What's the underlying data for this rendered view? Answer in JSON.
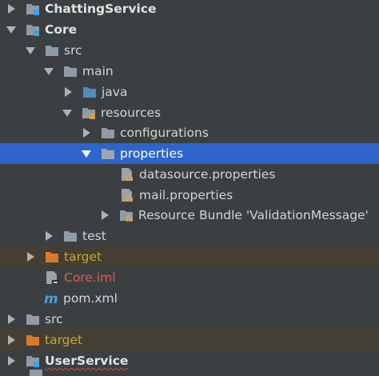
{
  "tree": {
    "items": [
      {
        "label": "ChattingService"
      },
      {
        "label": "Core"
      },
      {
        "label": "src"
      },
      {
        "label": "main"
      },
      {
        "label": "java"
      },
      {
        "label": "resources"
      },
      {
        "label": "configurations"
      },
      {
        "label": "properties"
      },
      {
        "label": "datasource.properties"
      },
      {
        "label": "mail.properties"
      },
      {
        "label": "Resource Bundle 'ValidationMessage'"
      },
      {
        "label": "test"
      },
      {
        "label": "target"
      },
      {
        "label": "Core.iml"
      },
      {
        "label": "pom.xml"
      },
      {
        "label": "src"
      },
      {
        "label": "target"
      },
      {
        "label": "UserService"
      }
    ]
  },
  "colors": {
    "background": "#3c3f41",
    "selection": "#2f65ca",
    "excluded_row": "#443f32",
    "folder_gray": "#8f9ba6",
    "folder_orange": "#d9792a",
    "source_folder_blue": "#4c8fb8",
    "module_badge": "#4a9fe0"
  },
  "icons": {
    "module": "module-folder-icon",
    "folder": "folder-icon",
    "source": "source-folder-icon",
    "resources": "resources-folder-icon",
    "excluded": "excluded-folder-icon",
    "properties": "properties-file-icon",
    "bundle": "resource-bundle-icon",
    "iml": "iml-file-icon",
    "maven": "maven-pom-icon"
  }
}
